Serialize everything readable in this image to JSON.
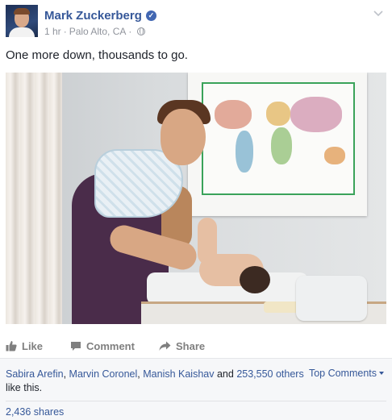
{
  "post": {
    "author": "Mark Zuckerberg",
    "time": "1 hr",
    "separator": "·",
    "location": "Palo Alto, CA",
    "text": "One more down, thousands to go."
  },
  "actions": {
    "like": "Like",
    "comment": "Comment",
    "share": "Share"
  },
  "likes": {
    "people": [
      "Sabira Arefin",
      "Marvin Coronel",
      "Manish Kaishav"
    ],
    "comma": ", ",
    "and": " and ",
    "others": "253,550 others",
    "suffix": "like this."
  },
  "top_comments": "Top Comments",
  "shares": "2,436 shares",
  "colors": {
    "link": "#365899",
    "footer_bg": "#f6f7f9",
    "verified": "#4267b2",
    "map_border": "#3aa35a"
  },
  "icons": [
    "chevron-down-icon",
    "verified-badge-icon",
    "globe-icon",
    "thumbs-up-icon",
    "comment-icon",
    "share-arrow-icon",
    "caret-down-icon"
  ]
}
